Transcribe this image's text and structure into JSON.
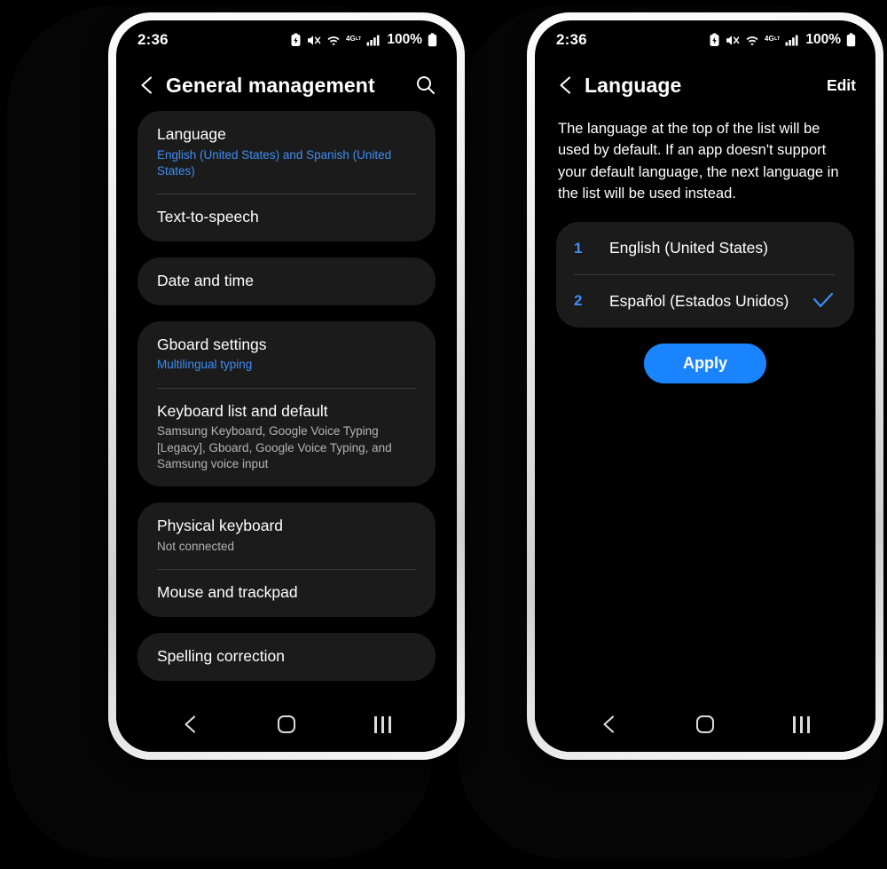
{
  "theme": {
    "accent_blue": "#3f8df5",
    "button_blue": "#1a84ff",
    "card_bg": "#1b1b1b",
    "screen_bg": "#000000",
    "frame": "#e9e9e9"
  },
  "phones": [
    {
      "status_bar": {
        "clock": "2:36",
        "battery_percent": "100%",
        "icons": [
          "power-saving-icon",
          "mute-icon",
          "wifi-icon",
          "4g-lte-icon",
          "signal-bars-icon",
          "battery-icon"
        ]
      },
      "app_bar": {
        "back_icon": "back-chevron-icon",
        "title": "General management",
        "action_icon": "search-icon"
      },
      "cards": [
        {
          "rows": [
            {
              "title": "Language",
              "sub": "English (United States) and Spanish (United States)",
              "sub_style": "accent"
            },
            {
              "title": "Text-to-speech",
              "sub": "",
              "sub_style": ""
            }
          ]
        },
        {
          "rows": [
            {
              "title": "Date and time",
              "sub": "",
              "sub_style": ""
            }
          ]
        },
        {
          "rows": [
            {
              "title": "Gboard settings",
              "sub": "Multilingual typing",
              "sub_style": "accent"
            },
            {
              "title": "Keyboard list and default",
              "sub": "Samsung Keyboard, Google Voice Typing [Legacy], Gboard, Google Voice Typing, and Samsung voice input",
              "sub_style": "muted"
            }
          ]
        },
        {
          "rows": [
            {
              "title": "Physical keyboard",
              "sub": "Not connected",
              "sub_style": "muted"
            },
            {
              "title": "Mouse and trackpad",
              "sub": "",
              "sub_style": ""
            }
          ]
        },
        {
          "rows": [
            {
              "title": "Spelling correction",
              "sub": "",
              "sub_style": ""
            }
          ]
        }
      ],
      "nav_bar": {
        "back": "back-chevron-icon",
        "home": "home-square-icon",
        "recents": "recents-bars-icon"
      }
    },
    {
      "status_bar": {
        "clock": "2:36",
        "battery_percent": "100%",
        "icons": [
          "power-saving-icon",
          "mute-icon",
          "wifi-icon",
          "4g-lte-icon",
          "signal-bars-icon",
          "battery-icon"
        ]
      },
      "app_bar": {
        "back_icon": "back-chevron-icon",
        "title": "Language",
        "action_label": "Edit"
      },
      "description": "The language at the top of the list will be used by default. If an app doesn't support your default language, the next language in the list will be used instead.",
      "languages": [
        {
          "index": "1",
          "name": "English (United States)",
          "selected": false
        },
        {
          "index": "2",
          "name": "Español (Estados Unidos)",
          "selected": true
        }
      ],
      "apply_label": "Apply",
      "nav_bar": {
        "back": "back-chevron-icon",
        "home": "home-square-icon",
        "recents": "recents-bars-icon"
      }
    }
  ]
}
